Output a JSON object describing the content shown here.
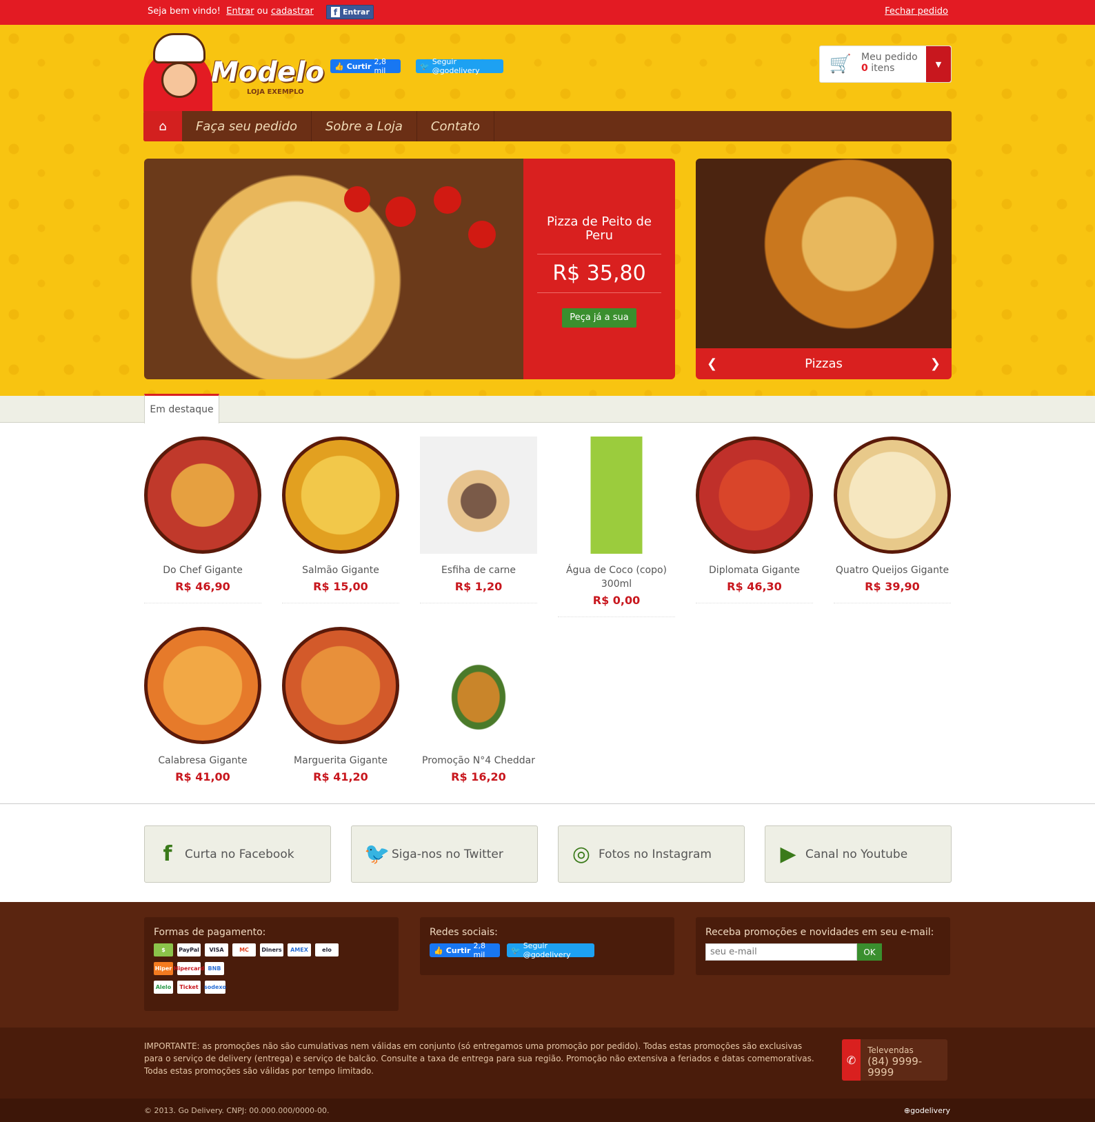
{
  "topbar": {
    "welcome": "Seja bem vindo!",
    "login_link": "Entrar",
    "or": "ou",
    "register_link": "cadastrar",
    "facebook_login": "Entrar",
    "close_order": "Fechar pedido"
  },
  "header": {
    "logo_name": "Modelo",
    "logo_sub": "LOJA EXEMPLO",
    "like_label": "Curtir",
    "like_count": "2,8 mil",
    "follow_label": "Seguir @godelivery",
    "cart_title": "Meu pedido",
    "cart_count": "0",
    "cart_unit": "itens"
  },
  "nav": {
    "items": [
      "Faça seu pedido",
      "Sobre a Loja",
      "Contato"
    ]
  },
  "promo": {
    "product": "Pizza de Peito de Peru",
    "price": "R$ 35,80",
    "cta": "Peça já a sua"
  },
  "slider": {
    "label": "Pizzas"
  },
  "featured_tab": "Em destaque",
  "products": [
    {
      "name": "Do Chef Gigante",
      "price": "R$ 46,90"
    },
    {
      "name": "Salmão Gigante",
      "price": "R$ 15,00"
    },
    {
      "name": "Esfiha de carne",
      "price": "R$ 1,20"
    },
    {
      "name": "Água de Coco (copo) 300ml",
      "price": "R$ 0,00"
    },
    {
      "name": "Diplomata Gigante",
      "price": "R$ 46,30"
    },
    {
      "name": "Quatro Queijos Gigante",
      "price": "R$ 39,90"
    },
    {
      "name": "Calabresa Gigante",
      "price": "R$ 41,00"
    },
    {
      "name": "Marguerita Gigante",
      "price": "R$ 41,20"
    },
    {
      "name": "Promoção N°4 Cheddar",
      "price": "R$ 16,20"
    }
  ],
  "social_boxes": [
    {
      "label": "Curta no Facebook",
      "icon": "facebook-icon"
    },
    {
      "label": "Siga-nos no Twitter",
      "icon": "twitter-icon"
    },
    {
      "label": "Fotos no Instagram",
      "icon": "instagram-icon"
    },
    {
      "label": "Canal no Youtube",
      "icon": "youtube-icon"
    }
  ],
  "footer": {
    "payments_title": "Formas de pagamento:",
    "payment_methods": [
      "$",
      "PayPal",
      "VISA",
      "MC",
      "Diners",
      "AMEX",
      "elo",
      "Hiper",
      "Hipercard",
      "BNB",
      "Alelo",
      "Ticket",
      "sodexo"
    ],
    "social_title": "Redes sociais:",
    "like_label": "Curtir",
    "like_count": "2,8 mil",
    "follow_label": "Seguir @godelivery",
    "newsletter_title": "Receba promoções e novidades em seu e-mail:",
    "email_placeholder": "seu e-mail",
    "ok_label": "OK"
  },
  "legal": {
    "text": "IMPORTANTE: as promoções não são cumulativas nem válidas em conjunto (só entregamos uma promoção por pedido). Todas estas promoções são exclusivas para o serviço de delivery (entrega) e serviço de balcão. Consulte a taxa de entrega para sua região. Promoção não extensiva a feriados e datas comemorativas. Todas estas promoções são válidas por tempo limitado.",
    "phone_label": "Televendas",
    "phone_number": "(84) 9999-9999"
  },
  "bottom": {
    "copyright": "© 2013. Go Delivery. CNPJ: 00.000.000/0000-00.",
    "credit": "⊕godelivery"
  },
  "colors": {
    "primary_red": "#e31b23",
    "brown": "#5a2510",
    "yellow": "#f8c411",
    "green": "#3a8f2e"
  }
}
